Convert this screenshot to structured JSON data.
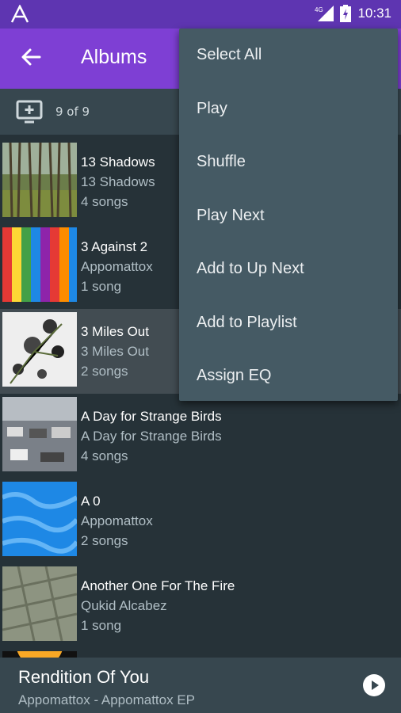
{
  "status": {
    "network": "4G",
    "time": "10:31"
  },
  "appbar": {
    "title": "Albums"
  },
  "subbar": {
    "count": "9 of 9"
  },
  "albums": [
    {
      "title": "13 Shadows",
      "artist": "13 Shadows",
      "songs": "4 songs"
    },
    {
      "title": "3 Against 2",
      "artist": "Appomattox",
      "songs": "1 song"
    },
    {
      "title": "3 Miles Out",
      "artist": "3 Miles Out",
      "songs": "2 songs"
    },
    {
      "title": "A Day for Strange Birds",
      "artist": "A Day for Strange Birds",
      "songs": "4 songs"
    },
    {
      "title": "A 0",
      "artist": "Appomattox",
      "songs": "2 songs"
    },
    {
      "title": "Another One For The Fire",
      "artist": "Qukid Alcabez",
      "songs": "1 song"
    }
  ],
  "menu": {
    "items": [
      "Select All",
      "Play",
      "Shuffle",
      "Play Next",
      "Add to Up Next",
      "Add to Playlist",
      "Assign EQ"
    ]
  },
  "now_playing": {
    "title": "Rendition Of You",
    "subtitle": "Appomattox - Appomattox EP"
  },
  "colors": {
    "status_bar": "#5e35b1",
    "app_bar": "#7e3fd4",
    "background": "#263238",
    "menu": "#455a64"
  }
}
